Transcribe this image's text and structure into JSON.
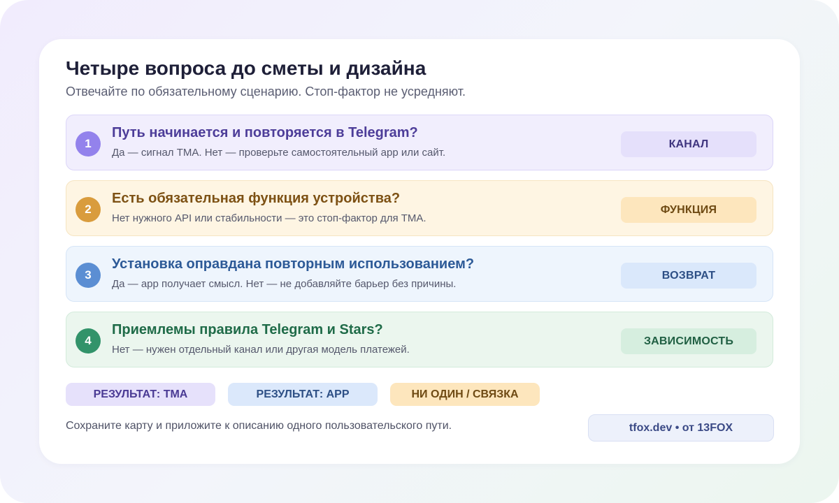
{
  "header": {
    "title": "Четыре вопроса до сметы и дизайна",
    "subtitle": "Отвечайте по обязательному сценарию. Стоп-фактор не усредняют."
  },
  "steps": [
    {
      "number": "1",
      "question": "Путь начинается и повторяется в Telegram?",
      "note": "Да — сигнал TMA. Нет — проверьте самостоятельный app или сайт.",
      "tag": "КАНАЛ",
      "colors": {
        "bg": "#f1eefd",
        "border": "#dcd6f8",
        "circle": "#9382ec",
        "question": "#4d3d99",
        "tag_bg": "#e5e0fb",
        "tag_text": "#3f357f"
      }
    },
    {
      "number": "2",
      "question": "Есть обязательная функция устройства?",
      "note": "Нет нужного API или стабильности — это стоп-фактор для TMA.",
      "tag": "ФУНКЦИЯ",
      "colors": {
        "bg": "#fef5e3",
        "border": "#f6e4c1",
        "circle": "#d99c3d",
        "question": "#7d5114",
        "tag_bg": "#fde6bd",
        "tag_text": "#6e4a13"
      }
    },
    {
      "number": "3",
      "question": "Установка оправдана повторным использованием?",
      "note": "Да — app получает смысл. Нет — не добавляйте барьер без причины.",
      "tag": "ВОЗВРАТ",
      "colors": {
        "bg": "#eef5fd",
        "border": "#d6e5f7",
        "circle": "#5b8ed3",
        "question": "#2d5a97",
        "tag_bg": "#dae8fb",
        "tag_text": "#2d4f85"
      }
    },
    {
      "number": "4",
      "question": "Приемлемы правила Telegram и Stars?",
      "note": "Нет — нужен отдельный канал или другая модель платежей.",
      "tag": "ЗАВИСИМОСТЬ",
      "colors": {
        "bg": "#ebf6ee",
        "border": "#d3ebdb",
        "circle": "#32936a",
        "question": "#1f6b48",
        "tag_bg": "#d6eedf",
        "tag_text": "#205f43"
      }
    }
  ],
  "results": [
    {
      "label": "РЕЗУЛЬТАТ: TMA",
      "bg": "#e6e1fb",
      "text": "#4a3a94"
    },
    {
      "label": "РЕЗУЛЬТАТ: APP",
      "bg": "#dbe8fb",
      "text": "#2d4f85"
    },
    {
      "label": "НИ ОДИН / СВЯЗКА",
      "bg": "#fde6bd",
      "text": "#6e4a13"
    }
  ],
  "footer": {
    "note": "Сохраните карту и приложите к описанию одного пользовательского пути.",
    "credit": "tfox.dev • от 13FOX"
  }
}
